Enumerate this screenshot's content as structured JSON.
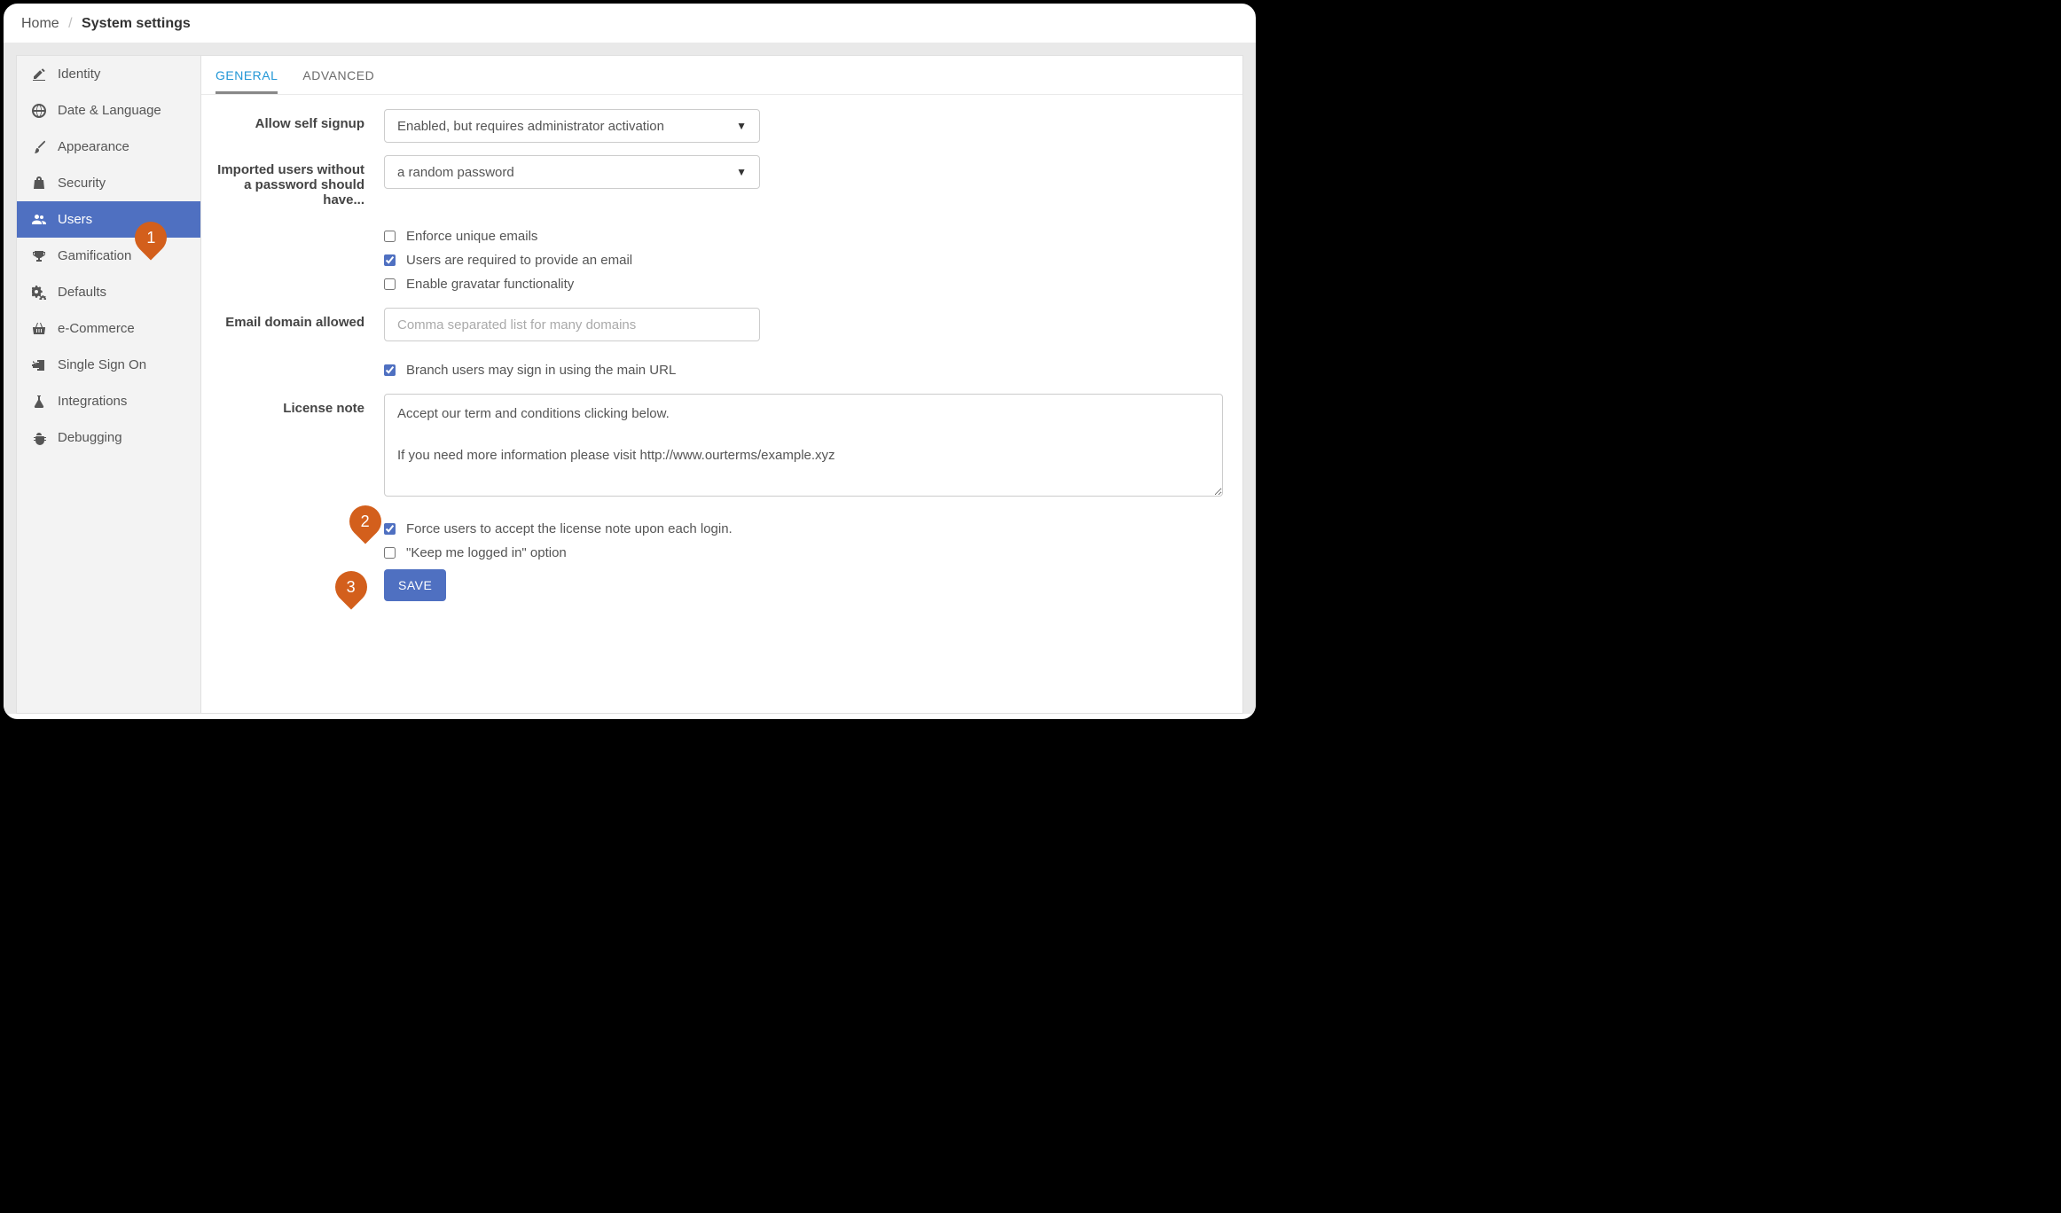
{
  "breadcrumb": {
    "home": "Home",
    "current": "System settings"
  },
  "sidebar": {
    "items": [
      {
        "label": "Identity"
      },
      {
        "label": "Date & Language"
      },
      {
        "label": "Appearance"
      },
      {
        "label": "Security"
      },
      {
        "label": "Users"
      },
      {
        "label": "Gamification"
      },
      {
        "label": "Defaults"
      },
      {
        "label": "e-Commerce"
      },
      {
        "label": "Single Sign On"
      },
      {
        "label": "Integrations"
      },
      {
        "label": "Debugging"
      }
    ]
  },
  "tabs": {
    "general": "GENERAL",
    "advanced": "ADVANCED"
  },
  "form": {
    "allow_self_signup": {
      "label": "Allow self signup",
      "value": "Enabled, but requires administrator activation"
    },
    "imported_users": {
      "label": "Imported users without a password should have...",
      "value": "a random password"
    },
    "enforce_unique_emails": {
      "label": "Enforce unique emails",
      "checked": false
    },
    "require_email": {
      "label": "Users are required to provide an email",
      "checked": true
    },
    "enable_gravatar": {
      "label": "Enable gravatar functionality",
      "checked": false
    },
    "email_domain_allowed": {
      "label": "Email domain allowed",
      "placeholder": "Comma separated list for many domains"
    },
    "branch_signin": {
      "label": "Branch users may sign in using the main URL",
      "checked": true
    },
    "license_note": {
      "label": "License note",
      "value": "Accept our term and conditions clicking below.\n\nIf you need more information please visit http://www.ourterms/example.xyz"
    },
    "force_accept_license": {
      "label": "Force users to accept the license note upon each login.",
      "checked": true
    },
    "keep_logged_in": {
      "label": "\"Keep me logged in\" option",
      "checked": false
    },
    "save": "SAVE"
  },
  "callouts": {
    "one": "1",
    "two": "2",
    "three": "3"
  }
}
